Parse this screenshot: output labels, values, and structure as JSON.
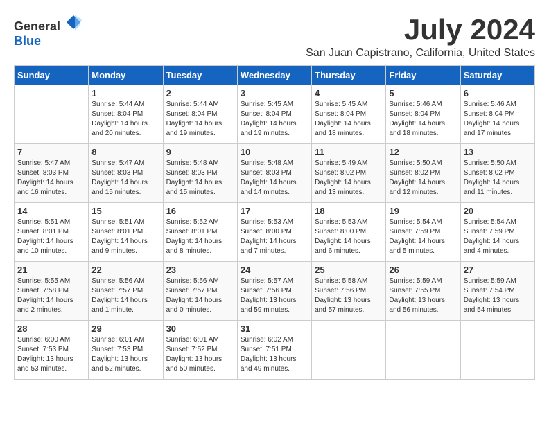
{
  "app": {
    "name_general": "General",
    "name_blue": "Blue"
  },
  "header": {
    "month": "July 2024",
    "location": "San Juan Capistrano, California, United States"
  },
  "days_of_week": [
    "Sunday",
    "Monday",
    "Tuesday",
    "Wednesday",
    "Thursday",
    "Friday",
    "Saturday"
  ],
  "weeks": [
    [
      {
        "day": "",
        "content": ""
      },
      {
        "day": "1",
        "content": "Sunrise: 5:44 AM\nSunset: 8:04 PM\nDaylight: 14 hours\nand 20 minutes."
      },
      {
        "day": "2",
        "content": "Sunrise: 5:44 AM\nSunset: 8:04 PM\nDaylight: 14 hours\nand 19 minutes."
      },
      {
        "day": "3",
        "content": "Sunrise: 5:45 AM\nSunset: 8:04 PM\nDaylight: 14 hours\nand 19 minutes."
      },
      {
        "day": "4",
        "content": "Sunrise: 5:45 AM\nSunset: 8:04 PM\nDaylight: 14 hours\nand 18 minutes."
      },
      {
        "day": "5",
        "content": "Sunrise: 5:46 AM\nSunset: 8:04 PM\nDaylight: 14 hours\nand 18 minutes."
      },
      {
        "day": "6",
        "content": "Sunrise: 5:46 AM\nSunset: 8:04 PM\nDaylight: 14 hours\nand 17 minutes."
      }
    ],
    [
      {
        "day": "7",
        "content": "Sunrise: 5:47 AM\nSunset: 8:03 PM\nDaylight: 14 hours\nand 16 minutes."
      },
      {
        "day": "8",
        "content": "Sunrise: 5:47 AM\nSunset: 8:03 PM\nDaylight: 14 hours\nand 15 minutes."
      },
      {
        "day": "9",
        "content": "Sunrise: 5:48 AM\nSunset: 8:03 PM\nDaylight: 14 hours\nand 15 minutes."
      },
      {
        "day": "10",
        "content": "Sunrise: 5:48 AM\nSunset: 8:03 PM\nDaylight: 14 hours\nand 14 minutes."
      },
      {
        "day": "11",
        "content": "Sunrise: 5:49 AM\nSunset: 8:02 PM\nDaylight: 14 hours\nand 13 minutes."
      },
      {
        "day": "12",
        "content": "Sunrise: 5:50 AM\nSunset: 8:02 PM\nDaylight: 14 hours\nand 12 minutes."
      },
      {
        "day": "13",
        "content": "Sunrise: 5:50 AM\nSunset: 8:02 PM\nDaylight: 14 hours\nand 11 minutes."
      }
    ],
    [
      {
        "day": "14",
        "content": "Sunrise: 5:51 AM\nSunset: 8:01 PM\nDaylight: 14 hours\nand 10 minutes."
      },
      {
        "day": "15",
        "content": "Sunrise: 5:51 AM\nSunset: 8:01 PM\nDaylight: 14 hours\nand 9 minutes."
      },
      {
        "day": "16",
        "content": "Sunrise: 5:52 AM\nSunset: 8:01 PM\nDaylight: 14 hours\nand 8 minutes."
      },
      {
        "day": "17",
        "content": "Sunrise: 5:53 AM\nSunset: 8:00 PM\nDaylight: 14 hours\nand 7 minutes."
      },
      {
        "day": "18",
        "content": "Sunrise: 5:53 AM\nSunset: 8:00 PM\nDaylight: 14 hours\nand 6 minutes."
      },
      {
        "day": "19",
        "content": "Sunrise: 5:54 AM\nSunset: 7:59 PM\nDaylight: 14 hours\nand 5 minutes."
      },
      {
        "day": "20",
        "content": "Sunrise: 5:54 AM\nSunset: 7:59 PM\nDaylight: 14 hours\nand 4 minutes."
      }
    ],
    [
      {
        "day": "21",
        "content": "Sunrise: 5:55 AM\nSunset: 7:58 PM\nDaylight: 14 hours\nand 2 minutes."
      },
      {
        "day": "22",
        "content": "Sunrise: 5:56 AM\nSunset: 7:57 PM\nDaylight: 14 hours\nand 1 minute."
      },
      {
        "day": "23",
        "content": "Sunrise: 5:56 AM\nSunset: 7:57 PM\nDaylight: 14 hours\nand 0 minutes."
      },
      {
        "day": "24",
        "content": "Sunrise: 5:57 AM\nSunset: 7:56 PM\nDaylight: 13 hours\nand 59 minutes."
      },
      {
        "day": "25",
        "content": "Sunrise: 5:58 AM\nSunset: 7:56 PM\nDaylight: 13 hours\nand 57 minutes."
      },
      {
        "day": "26",
        "content": "Sunrise: 5:59 AM\nSunset: 7:55 PM\nDaylight: 13 hours\nand 56 minutes."
      },
      {
        "day": "27",
        "content": "Sunrise: 5:59 AM\nSunset: 7:54 PM\nDaylight: 13 hours\nand 54 minutes."
      }
    ],
    [
      {
        "day": "28",
        "content": "Sunrise: 6:00 AM\nSunset: 7:53 PM\nDaylight: 13 hours\nand 53 minutes."
      },
      {
        "day": "29",
        "content": "Sunrise: 6:01 AM\nSunset: 7:53 PM\nDaylight: 13 hours\nand 52 minutes."
      },
      {
        "day": "30",
        "content": "Sunrise: 6:01 AM\nSunset: 7:52 PM\nDaylight: 13 hours\nand 50 minutes."
      },
      {
        "day": "31",
        "content": "Sunrise: 6:02 AM\nSunset: 7:51 PM\nDaylight: 13 hours\nand 49 minutes."
      },
      {
        "day": "",
        "content": ""
      },
      {
        "day": "",
        "content": ""
      },
      {
        "day": "",
        "content": ""
      }
    ]
  ]
}
